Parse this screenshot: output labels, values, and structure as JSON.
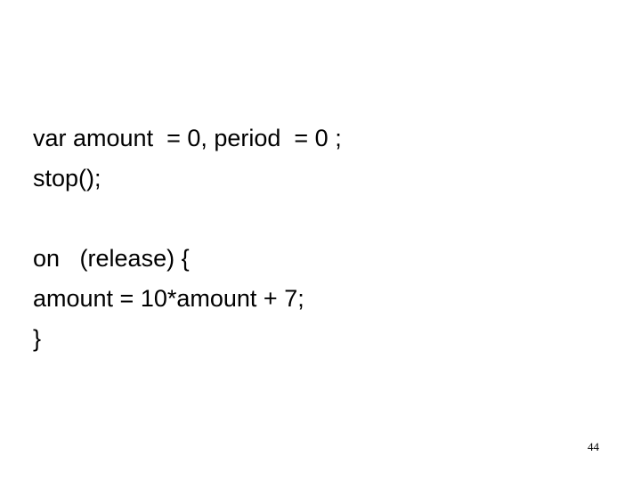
{
  "slide": {
    "background_color": "#ffffff",
    "text_color": "#000000",
    "code_lines": [
      {
        "text": "var amount  = 0, period  = 0 ;",
        "blank": false
      },
      {
        "text": "stop();",
        "blank": false
      },
      {
        "text": "",
        "blank": true
      },
      {
        "text": "on   (release) {",
        "blank": false
      },
      {
        "text": "amount = 10*amount + 7;",
        "blank": false
      },
      {
        "text": "}",
        "blank": false
      }
    ],
    "page_number": "44"
  }
}
